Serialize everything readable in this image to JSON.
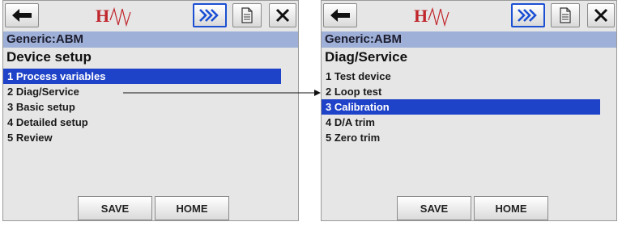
{
  "screens": [
    {
      "toolbar": {
        "back": "back-arrow-icon",
        "logo": "HART",
        "forward": "double-chevron-right-icon",
        "document": "document-icon",
        "close": "close-icon"
      },
      "device": "Generic:ABM",
      "title": "Device setup",
      "items": [
        "1 Process variables",
        "2 Diag/Service",
        "3 Basic setup",
        "4 Detailed setup",
        "5 Review"
      ],
      "selected_index": 0,
      "buttons": {
        "save": "SAVE",
        "home": "HOME"
      }
    },
    {
      "toolbar": {
        "back": "back-arrow-icon",
        "logo": "HART",
        "forward": "double-chevron-right-icon",
        "document": "document-icon",
        "close": "close-icon"
      },
      "device": "Generic:ABM",
      "title": "Diag/Service",
      "items": [
        "1 Test device",
        "2 Loop test",
        "3 Calibration",
        "4 D/A trim",
        "5 Zero trim"
      ],
      "selected_index": 2,
      "buttons": {
        "save": "SAVE",
        "home": "HOME"
      }
    }
  ],
  "colors": {
    "selection": "#1f43c8",
    "device_bar": "#9eb0d8",
    "forward_border": "#1b4fd4",
    "logo_red": "#c0262c",
    "screen_bg": "#e6e6e6"
  }
}
